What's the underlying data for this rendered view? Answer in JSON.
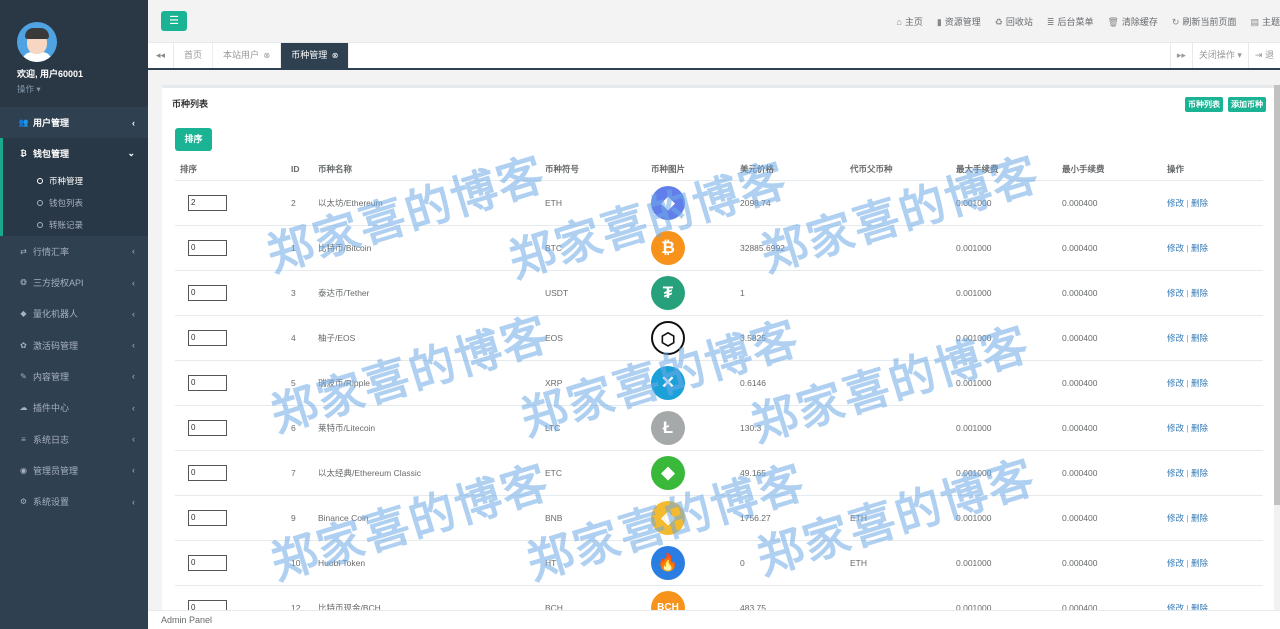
{
  "sidebar": {
    "welcome": "欢迎, 用户60001",
    "op": "操作",
    "menu": [
      {
        "label": "用户管理",
        "icon": "users-icon",
        "glyph": "👥"
      },
      {
        "label": "钱包管理",
        "icon": "bitcoin-icon",
        "glyph": "₿"
      },
      {
        "label": "行情汇率",
        "icon": "exchange-icon",
        "glyph": "⇄"
      },
      {
        "label": "三方授权API",
        "icon": "cube-icon",
        "glyph": "❂"
      },
      {
        "label": "量化机器人",
        "icon": "robot-icon",
        "glyph": "◆"
      },
      {
        "label": "激活码管理",
        "icon": "gear-icon",
        "glyph": "✿"
      },
      {
        "label": "内容管理",
        "icon": "edit-icon",
        "glyph": "✎"
      },
      {
        "label": "插件中心",
        "icon": "cloud-icon",
        "glyph": "☁"
      },
      {
        "label": "系统日志",
        "icon": "database-icon",
        "glyph": "≡"
      },
      {
        "label": "管理员管理",
        "icon": "user-circle-icon",
        "glyph": "◉"
      },
      {
        "label": "系统设置",
        "icon": "cogs-icon",
        "glyph": "⚙"
      }
    ],
    "submenu": [
      "币种管理",
      "钱包列表",
      "转账记录"
    ]
  },
  "topbar": {
    "menu_glyph": "☰",
    "links": [
      {
        "label": "主页",
        "icon": "home-icon",
        "glyph": "⌂"
      },
      {
        "label": "资源管理",
        "icon": "file-icon",
        "glyph": "▮"
      },
      {
        "label": "回收站",
        "icon": "recycle-icon",
        "glyph": "♻"
      },
      {
        "label": "后台菜单",
        "icon": "list-icon",
        "glyph": "≣"
      },
      {
        "label": "清除缓存",
        "icon": "trash-icon",
        "glyph": "🗑"
      },
      {
        "label": "刷新当前页面",
        "icon": "refresh-icon",
        "glyph": "↻"
      },
      {
        "label": "主题",
        "icon": "theme-icon",
        "glyph": "▤"
      }
    ]
  },
  "tabs": {
    "left_glyph": "◂◂",
    "items": [
      {
        "label": "首页",
        "closable": false
      },
      {
        "label": "本站用户",
        "closable": true
      },
      {
        "label": "币种管理",
        "closable": true
      }
    ],
    "close_glyph": "⊗",
    "right_next_glyph": "▸▸",
    "close_ops": "关闭操作",
    "logout": "退"
  },
  "panel": {
    "title": "币种列表",
    "btn_list": "币种列表",
    "btn_add": "添加币种",
    "sort_btn": "排序",
    "columns": [
      "排序",
      "ID",
      "币种名称",
      "币种符号",
      "币种图片",
      "美元价格",
      "代币父币种",
      "最大手续费",
      "最小手续费",
      "操作"
    ],
    "rows": [
      {
        "sort": "2",
        "id": "2",
        "name": "以太坊/Ethereum",
        "symbol": "ETH",
        "icon": "ethereum-icon",
        "glyph": "◆",
        "color": "#627eea",
        "price": "2098.74",
        "parent": "",
        "max_fee": "0.001000",
        "min_fee": "0.000400"
      },
      {
        "sort": "0",
        "id": "1",
        "name": "比特币/Bitcoin",
        "symbol": "BTC",
        "icon": "bitcoin-icon",
        "glyph": "₿",
        "color": "#f7931a",
        "price": "32885.6992",
        "parent": "",
        "max_fee": "0.001000",
        "min_fee": "0.000400"
      },
      {
        "sort": "0",
        "id": "3",
        "name": "泰达币/Tether",
        "symbol": "USDT",
        "icon": "tether-icon",
        "glyph": "₮",
        "color": "#26a17b",
        "price": "1",
        "parent": "",
        "max_fee": "0.001000",
        "min_fee": "0.000400"
      },
      {
        "sort": "0",
        "id": "4",
        "name": "柚子/EOS",
        "symbol": "EOS",
        "icon": "eos-icon",
        "glyph": "⬡",
        "color": "#ffffff",
        "price": "3.5825",
        "parent": "",
        "max_fee": "0.001000",
        "min_fee": "0.000400"
      },
      {
        "sort": "0",
        "id": "5",
        "name": "瑞波币/Ripple",
        "symbol": "XRP",
        "icon": "ripple-icon",
        "glyph": "✕",
        "color": "#1ba0d8",
        "price": "0.6146",
        "parent": "",
        "max_fee": "0.001000",
        "min_fee": "0.000400"
      },
      {
        "sort": "0",
        "id": "6",
        "name": "莱特币/Litecoin",
        "symbol": "LTC",
        "icon": "litecoin-icon",
        "glyph": "Ł",
        "color": "#a6a9aa",
        "price": "130.3",
        "parent": "",
        "max_fee": "0.001000",
        "min_fee": "0.000400"
      },
      {
        "sort": "0",
        "id": "7",
        "name": "以太经典/Ethereum Classic",
        "symbol": "ETC",
        "icon": "ethereum-classic-icon",
        "glyph": "◆",
        "color": "#3ab83a",
        "price": "49.165",
        "parent": "",
        "max_fee": "0.001000",
        "min_fee": "0.000400"
      },
      {
        "sort": "0",
        "id": "9",
        "name": "Binance Coin",
        "symbol": "BNB",
        "icon": "binance-icon",
        "glyph": "◈",
        "color": "#f3ba2f",
        "price": "1756.27",
        "parent": "ETH",
        "max_fee": "0.001000",
        "min_fee": "0.000400"
      },
      {
        "sort": "0",
        "id": "10",
        "name": "Huobi Token",
        "symbol": "HT",
        "icon": "huobi-icon",
        "glyph": "🔥",
        "color": "#2a7de1",
        "price": "0",
        "parent": "ETH",
        "max_fee": "0.001000",
        "min_fee": "0.000400"
      },
      {
        "sort": "0",
        "id": "12",
        "name": "比特币现金/BCH",
        "symbol": "BCH",
        "icon": "bitcoin-cash-icon",
        "glyph": "BCH",
        "color": "#f7931a",
        "price": "483.75",
        "parent": "",
        "max_fee": "0.001000",
        "min_fee": "0.000400"
      }
    ],
    "edit_label": "修改",
    "delete_label": "删除",
    "sep": "|"
  },
  "footer": "Admin Panel",
  "watermark": "郑家喜的博客"
}
